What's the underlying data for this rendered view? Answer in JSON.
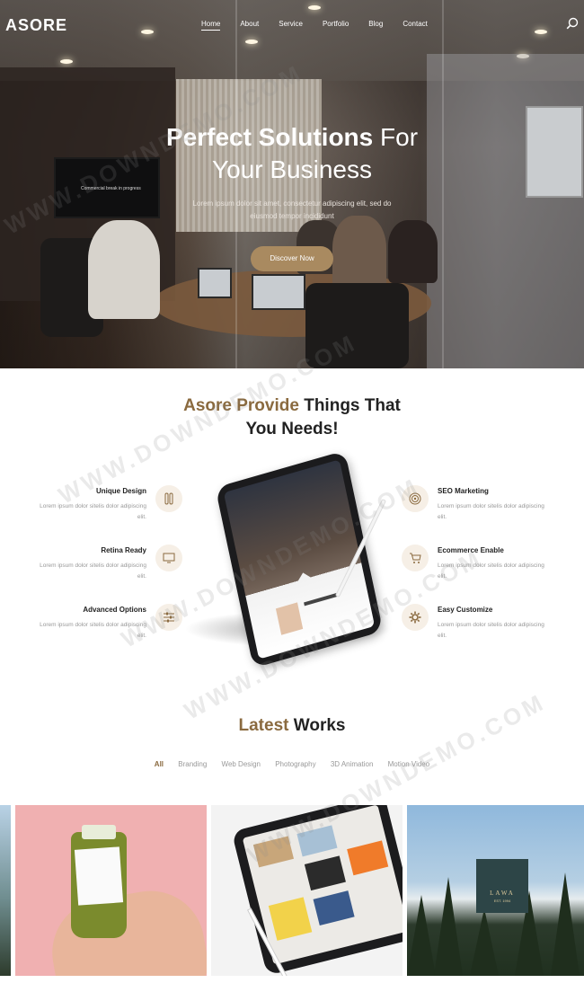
{
  "nav": {
    "logo": "ASORE",
    "items": [
      "Home",
      "About",
      "Service",
      "Portfolio",
      "Blog",
      "Contact"
    ],
    "active": "Home"
  },
  "hero": {
    "title_bold": "Perfect Solutions",
    "title_rest": "For",
    "title_line2": "Your Business",
    "text": "Lorem ipsum dolor sit amet, consectetur adipiscing elit, sed do eiusmod tempor incididunt",
    "button": "Discover Now",
    "tv_caption": "Commercial break in progress"
  },
  "services": {
    "title_accent": "Asore Provide",
    "title_rest": "Things That",
    "title_line2": "You Needs!",
    "left": [
      {
        "title": "Unique Design",
        "text": "Lorem ipsum dolor sitelis dolor adipiscing elit.",
        "icon": "pen-tools-icon"
      },
      {
        "title": "Retina Ready",
        "text": "Lorem ipsum dolor sitelis dolor adipiscing elit.",
        "icon": "monitor-icon"
      },
      {
        "title": "Advanced Options",
        "text": "Lorem ipsum dolor sitelis dolor adipiscing elit.",
        "icon": "sliders-icon"
      }
    ],
    "right": [
      {
        "title": "SEO Marketing",
        "text": "Lorem ipsum dolor sitelis dolor adipiscing elit.",
        "icon": "target-icon"
      },
      {
        "title": "Ecommerce Enable",
        "text": "Lorem ipsum dolor sitelis dolor adipiscing elit.",
        "icon": "cart-icon"
      },
      {
        "title": "Easy Customize",
        "text": "Lorem ipsum dolor sitelis dolor adipiscing elit.",
        "icon": "gear-icon"
      }
    ]
  },
  "works": {
    "title_accent": "Latest",
    "title_rest": "Works",
    "filters": [
      "All",
      "Branding",
      "Web Design",
      "Photography",
      "3D Animation",
      "Motion Video"
    ],
    "active_filter": "All",
    "lawa_logo": "LAWA",
    "lawa_sub": "EST. 1994"
  },
  "watermark": "WWW.DOWNDEMO.COM",
  "colors": {
    "accent": "#8a6a3f",
    "button": "#a98a60",
    "icon_bg": "#f6efe6"
  }
}
